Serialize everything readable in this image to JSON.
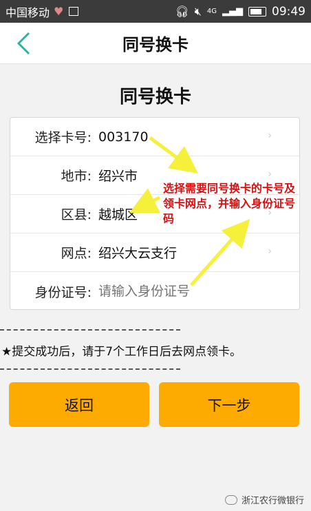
{
  "status_bar": {
    "carrier": "中国移动",
    "network": "4G",
    "time": "09:49"
  },
  "nav": {
    "title": "同号换卡"
  },
  "form": {
    "heading": "同号换卡",
    "rows": [
      {
        "label": "选择卡号:",
        "value": "003170"
      },
      {
        "label": "地市:",
        "value": "绍兴市"
      },
      {
        "label": "区县:",
        "value": "越城区"
      },
      {
        "label": "网点:",
        "value": "绍兴大云支行"
      },
      {
        "label": "身份证号:",
        "placeholder": "请输入身份证号"
      }
    ]
  },
  "annotation": {
    "text": "选择需要同号换卡的卡号及领卡网点，并输入身份证号码",
    "color": "#d61010"
  },
  "notice": "★提交成功后，请于7个工作日后去网点领卡。",
  "buttons": {
    "back": "返回",
    "next": "下一步",
    "color": "#fdab00"
  },
  "watermark": "浙江农行微银行",
  "icons": {
    "back": "chevron-left-icon",
    "row_arrow": "chevron-right-icon",
    "arrow": "annotation-arrow-icon"
  }
}
